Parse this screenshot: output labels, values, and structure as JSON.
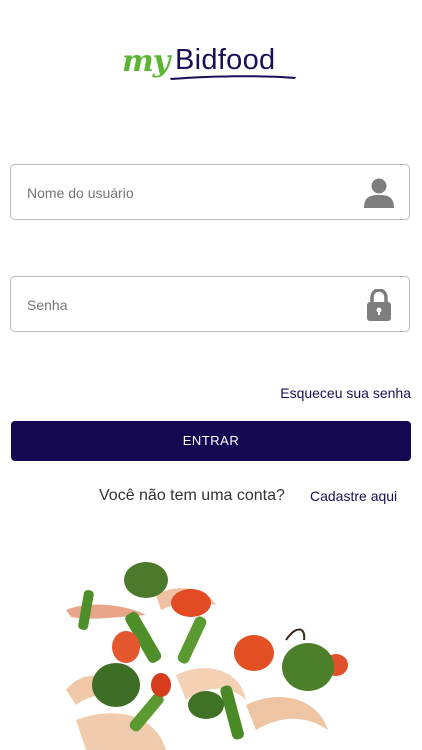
{
  "logo": {
    "my": "my",
    "brand": "Bidfood"
  },
  "username": {
    "placeholder": "Nome do usuário",
    "icon": "user-icon"
  },
  "password": {
    "placeholder": "Senha",
    "icon": "lock-icon"
  },
  "forgot_link": "Esqueceu sua senha",
  "submit_label": "ENTRAR",
  "signup": {
    "prompt": "Você não tem uma conta?",
    "link": "Cadastre aqui"
  },
  "colors": {
    "brand_navy": "#140852",
    "brand_green": "#5cb532"
  },
  "food_image": "vegetables-and-shrimp-illustration"
}
